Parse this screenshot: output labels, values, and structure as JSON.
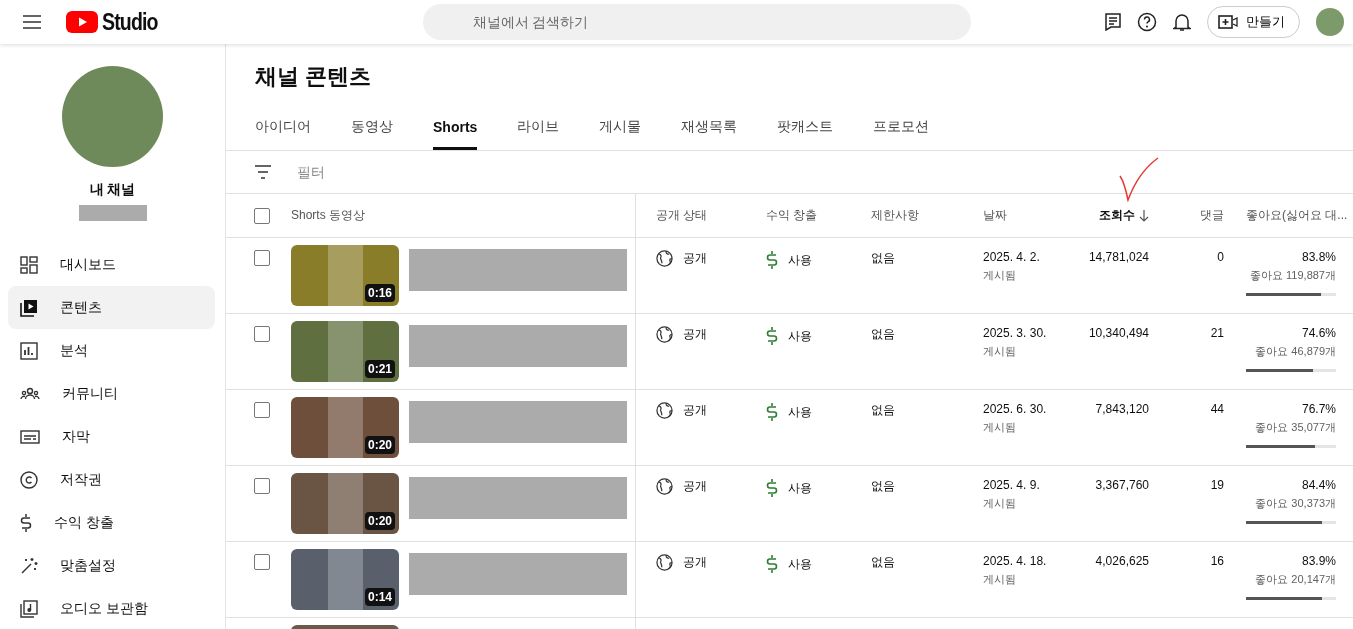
{
  "header": {
    "logo_text": "Studio",
    "search": {
      "placeholder": "채널에서 검색하기"
    },
    "create_button": "만들기"
  },
  "sidebar": {
    "channel_label": "내 채널",
    "items": [
      {
        "label": "대시보드",
        "selected": false
      },
      {
        "label": "콘텐츠",
        "selected": true
      },
      {
        "label": "분석",
        "selected": false
      },
      {
        "label": "커뮤니티",
        "selected": false
      },
      {
        "label": "자막",
        "selected": false
      },
      {
        "label": "저작권",
        "selected": false
      },
      {
        "label": "수익 창출",
        "selected": false
      },
      {
        "label": "맞춤설정",
        "selected": false
      },
      {
        "label": "오디오 보관함",
        "selected": false
      }
    ]
  },
  "page_title": "채널 콘텐츠",
  "tabs": [
    {
      "label": "아이디어",
      "selected": false
    },
    {
      "label": "동영상",
      "selected": false
    },
    {
      "label": "Shorts",
      "selected": true
    },
    {
      "label": "라이브",
      "selected": false
    },
    {
      "label": "게시물",
      "selected": false
    },
    {
      "label": "재생목록",
      "selected": false
    },
    {
      "label": "팟캐스트",
      "selected": false
    },
    {
      "label": "프로모션",
      "selected": false
    }
  ],
  "filter": {
    "placeholder": "필터"
  },
  "table": {
    "select_all_checked": false,
    "columns": [
      {
        "label": "Shorts 동영상",
        "sorted": false
      },
      {
        "label": "공개 상태",
        "sorted": false
      },
      {
        "label": "수익 창출",
        "sorted": false
      },
      {
        "label": "제한사항",
        "sorted": false
      },
      {
        "label": "날짜",
        "sorted": false
      },
      {
        "label": "조회수",
        "sorted": true
      },
      {
        "label": "댓글",
        "sorted": false
      },
      {
        "label": "좋아요(싫어요 대...",
        "sorted": false
      }
    ],
    "rows": [
      {
        "checked": false,
        "duration": "0:16",
        "visibility": "공개",
        "monetization": "사용",
        "restrictions": "없음",
        "date": "2025. 4. 2.",
        "date_status": "게시됨",
        "views": "14,781,024",
        "comments": "0",
        "like_ratio": "83.8%",
        "likes": "좋아요 119,887개",
        "level": 0.838
      },
      {
        "checked": false,
        "duration": "0:21",
        "visibility": "공개",
        "monetization": "사용",
        "restrictions": "없음",
        "date": "2025. 3. 30.",
        "date_status": "게시됨",
        "views": "10,340,494",
        "comments": "21",
        "like_ratio": "74.6%",
        "likes": "좋아요 46,879개",
        "level": 0.746
      },
      {
        "checked": false,
        "duration": "0:20",
        "visibility": "공개",
        "monetization": "사용",
        "restrictions": "없음",
        "date": "2025. 6. 30.",
        "date_status": "게시됨",
        "views": "7,843,120",
        "comments": "44",
        "like_ratio": "76.7%",
        "likes": "좋아요 35,077개",
        "level": 0.767
      },
      {
        "checked": false,
        "duration": "0:20",
        "visibility": "공개",
        "monetization": "사용",
        "restrictions": "없음",
        "date": "2025. 4. 9.",
        "date_status": "게시됨",
        "views": "3,367,760",
        "comments": "19",
        "like_ratio": "84.4%",
        "likes": "좋아요 30,373개",
        "level": 0.844
      },
      {
        "checked": false,
        "duration": "0:14",
        "visibility": "공개",
        "monetization": "사용",
        "restrictions": "없음",
        "date": "2025. 4. 18.",
        "date_status": "게시됨",
        "views": "4,026,625",
        "comments": "16",
        "like_ratio": "83.9%",
        "likes": "좋아요 20,147개",
        "level": 0.839
      }
    ]
  }
}
